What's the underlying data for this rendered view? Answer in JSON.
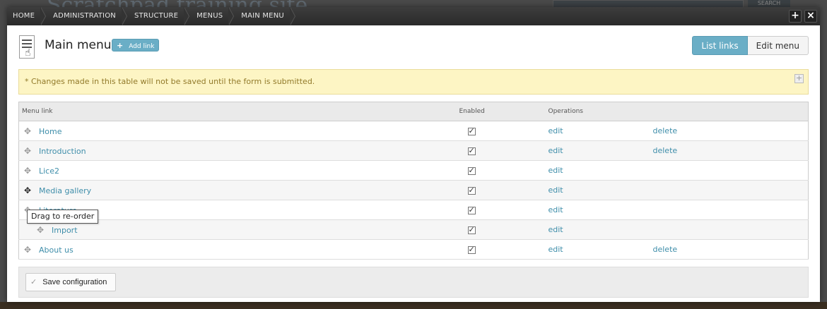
{
  "background": {
    "site_title": "Scratchpad training site",
    "search_button": "SEARCH"
  },
  "breadcrumb": [
    "HOME",
    "ADMINISTRATION",
    "STRUCTURE",
    "MENUS",
    "MAIN MENU"
  ],
  "window_buttons": {
    "expand": "+",
    "close": "×"
  },
  "header": {
    "title": "Main menu",
    "add_link_label": "Add link",
    "add_link_icon": "+"
  },
  "tabs": [
    {
      "label": "List links",
      "active": true
    },
    {
      "label": "Edit menu",
      "active": false
    }
  ],
  "notice": {
    "text": "* Changes made in this table will not be saved until the form is submitted.",
    "toggle": "+"
  },
  "table": {
    "headers": {
      "menu_link": "Menu link",
      "enabled": "Enabled",
      "operations": "Operations"
    },
    "rows": [
      {
        "label": "Home",
        "enabled": true,
        "edit": "edit",
        "delete": "delete",
        "indent": 0
      },
      {
        "label": "Introduction",
        "enabled": true,
        "edit": "edit",
        "delete": "delete",
        "indent": 0
      },
      {
        "label": "Lice2",
        "enabled": true,
        "edit": "edit",
        "delete": "",
        "indent": 0
      },
      {
        "label": "Media gallery",
        "enabled": true,
        "edit": "edit",
        "delete": "",
        "indent": 0
      },
      {
        "label": "Literature",
        "enabled": true,
        "edit": "edit",
        "delete": "",
        "indent": 0
      },
      {
        "label": "Import",
        "enabled": true,
        "edit": "edit",
        "delete": "",
        "indent": 1
      },
      {
        "label": "About us",
        "enabled": true,
        "edit": "edit",
        "delete": "delete",
        "indent": 0
      }
    ]
  },
  "tooltip": "Drag to re-order",
  "footer": {
    "save_label": "Save configuration",
    "save_icon": "✓"
  },
  "colors": {
    "accent": "#6aaec6",
    "link": "#3f8eaa",
    "notice_bg": "#fdf5c4",
    "notice_text": "#927a2a"
  }
}
